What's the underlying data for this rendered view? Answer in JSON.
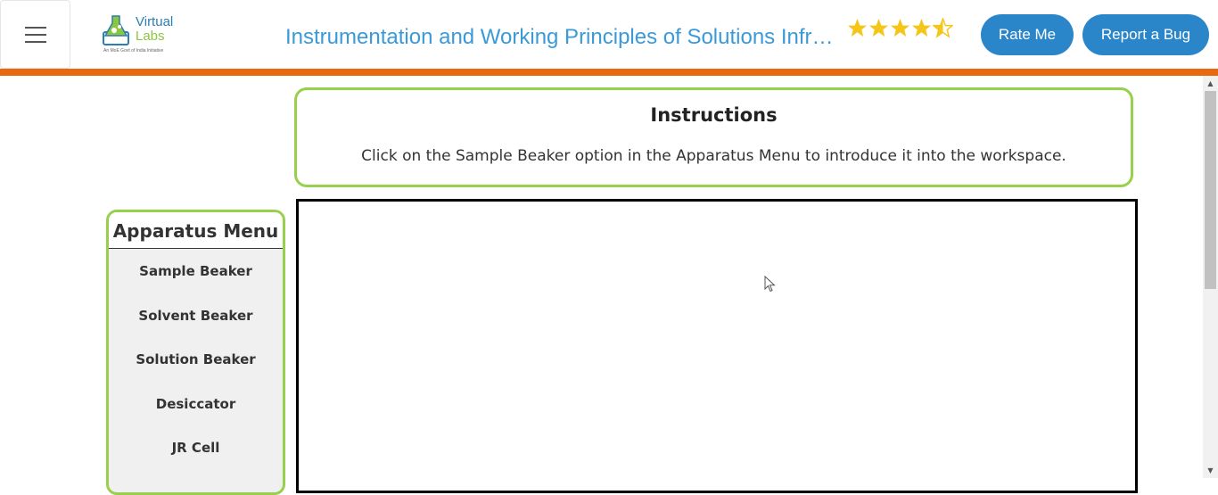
{
  "header": {
    "logo": {
      "line1": "Virtual",
      "line2": "Labs",
      "tagline": "An MoE Govt of India Initiative"
    },
    "title": "Instrumentation and Working Principles of Solutions Infrared Spectroscopy",
    "rating": 4.5,
    "rate_button": "Rate Me",
    "bug_button": "Report a Bug"
  },
  "instructions": {
    "heading": "Instructions",
    "text": "Click on the Sample Beaker option in the Apparatus Menu to introduce it into the workspace."
  },
  "apparatus_menu": {
    "title": "Apparatus Menu",
    "items": [
      "Sample Beaker",
      "Solvent Beaker",
      "Solution Beaker",
      "Desiccator",
      "JR Cell"
    ]
  },
  "colors": {
    "accent_orange": "#e86a10",
    "title_blue": "#3a9ad9",
    "button_blue": "#2a86c8",
    "border_green": "#98cf4d",
    "star_gold": "#f5c518"
  }
}
